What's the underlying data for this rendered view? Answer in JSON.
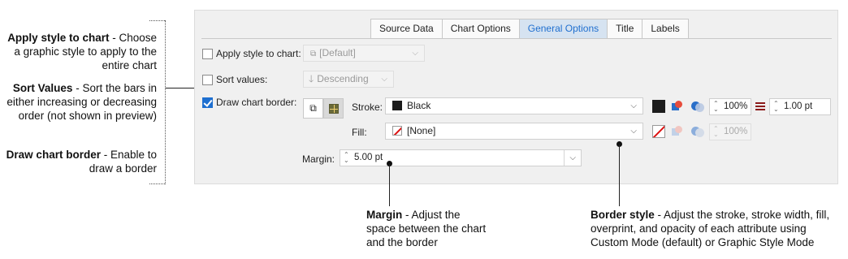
{
  "annotations_left": [
    {
      "title": "Apply style to chart",
      "text": " - Choose a graphic style to apply to the entire chart"
    },
    {
      "title": "Sort Values",
      "text": " - Sort the bars in either increasing or decreasing order (not shown in preview)"
    },
    {
      "title": "Draw chart border",
      "text": " - Enable to draw a border"
    }
  ],
  "tabs": [
    "Source Data",
    "Chart Options",
    "General Options",
    "Title",
    "Labels"
  ],
  "active_tab": "General Options",
  "apply_style": {
    "label": "Apply style to chart:",
    "value": "[Default]",
    "checked": false
  },
  "sort_values": {
    "label": "Sort values:",
    "value": "Descending",
    "checked": false
  },
  "draw_border": {
    "label": "Draw chart border:",
    "checked": true
  },
  "stroke": {
    "label": "Stroke:",
    "value": "Black",
    "opacity": "100%",
    "width": "1.00 pt"
  },
  "fill": {
    "label": "Fill:",
    "value": "[None]",
    "opacity": "100%"
  },
  "margin": {
    "label": "Margin:",
    "value": "5.00 pt"
  },
  "annotations_bottom": [
    {
      "title": "Margin",
      "text": " - Adjust the space between the chart and the border"
    },
    {
      "title": "Border style",
      "text": " - Adjust the stroke, stroke width, fill, overprint, and opacity of each attribute using Custom Mode (default) or Graphic Style Mode"
    }
  ],
  "colors": {
    "accent": "#1e6fd0",
    "active_tab_bg": "#d6e3f1",
    "stroke_color": "#1c1c1c",
    "stroke_width_icon": "#8b1a1a"
  }
}
